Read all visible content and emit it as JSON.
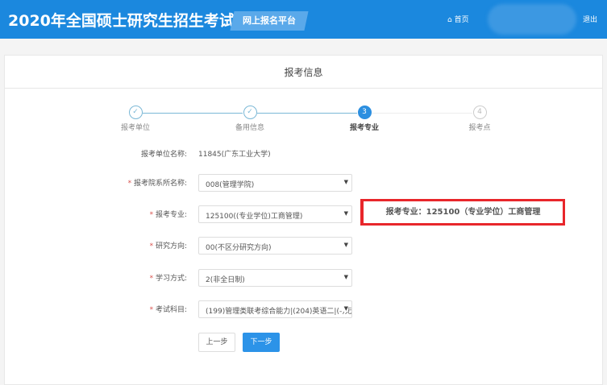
{
  "header": {
    "title": "2020年全国硕士研究生招生考试",
    "platform": "网上报名平台",
    "home": "首页",
    "logout": "退出"
  },
  "card": {
    "title": "报考信息"
  },
  "steps": [
    {
      "n": "✓",
      "label": "报考单位"
    },
    {
      "n": "✓",
      "label": "备用信息"
    },
    {
      "n": "3",
      "label": "报考专业"
    },
    {
      "n": "4",
      "label": "报考点"
    }
  ],
  "form": {
    "unit": {
      "label": "报考单位名称:",
      "value": "11845(广东工业大学)"
    },
    "dept": {
      "label": "报考院系所名称:",
      "value": "008(管理学院)"
    },
    "major": {
      "label": "报考专业:",
      "value": "125100((专业学位)工商管理)"
    },
    "direction": {
      "label": "研究方向:",
      "value": "00(不区分研究方向)"
    },
    "mode": {
      "label": "学习方式:",
      "value": "2(非全日制)"
    },
    "subjects": {
      "label": "考试科目:",
      "value": "(199)管理类联考综合能力|(204)英语二|(-)无"
    },
    "required": "*",
    "prev": "上一步",
    "next": "下一步"
  },
  "annotation": "报考专业：125100（专业学位）工商管理"
}
